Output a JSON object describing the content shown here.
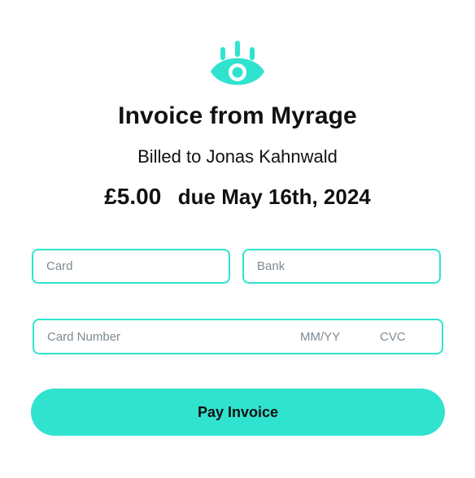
{
  "brand": {
    "logo_icon": "eye-logo-icon",
    "accent_color": "#30e3cf"
  },
  "invoice": {
    "title": "Invoice from Myrage",
    "billed_to": "Billed to Jonas Kahnwald",
    "amount": "£5.00",
    "due": "due May 16th, 2024"
  },
  "payment_methods": {
    "card_label": "Card",
    "bank_label": "Bank"
  },
  "card_form": {
    "number_placeholder": "Card Number",
    "expiry_placeholder": "MM/YY",
    "cvc_placeholder": "CVC"
  },
  "actions": {
    "pay_label": "Pay Invoice"
  }
}
